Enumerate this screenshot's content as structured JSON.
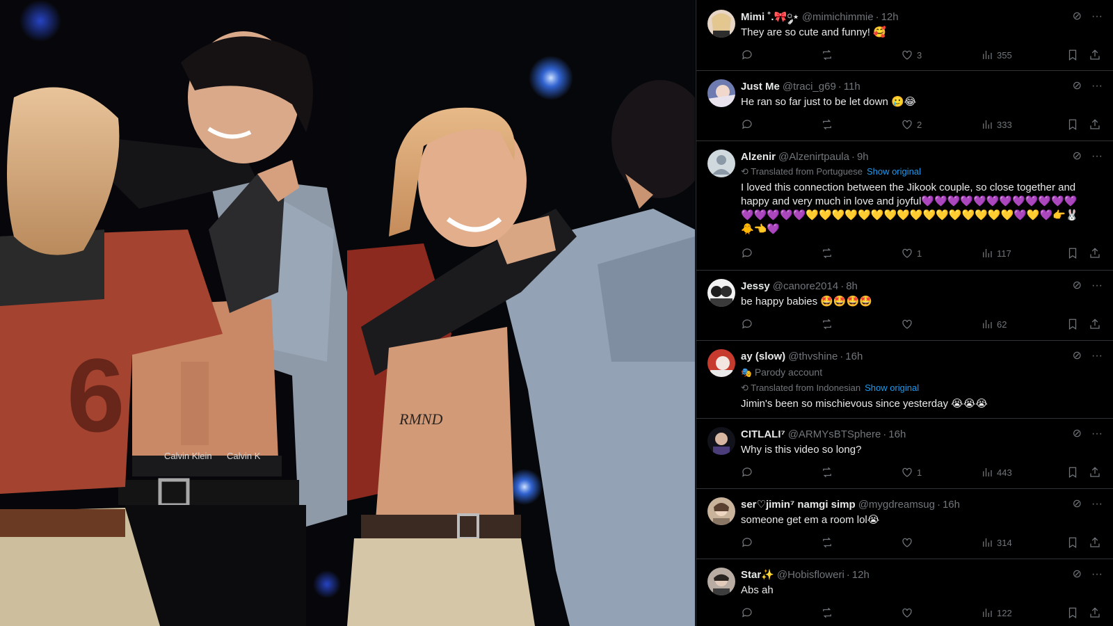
{
  "icons": {
    "reply": "reply-icon",
    "repost": "repost-icon",
    "like": "like-icon",
    "views": "views-icon",
    "bookmark": "bookmark-icon",
    "share": "share-icon",
    "grok": "grok-icon",
    "more": "more-icon"
  },
  "photos": {
    "left_waistband_text": "Calvin Klein",
    "left_waistband_text2": "Calvin K",
    "right_tattoo_text": "RMND"
  },
  "replies": [
    {
      "display_name": "Mimi ˚.🎀༘⋆",
      "handle": "@mimichimmie",
      "time": "12h",
      "text": "They are so cute and funny! 🥰",
      "likes": "3",
      "views": "355"
    },
    {
      "display_name": "Just Me",
      "handle": "@traci_g69",
      "time": "11h",
      "text": "He ran so far just to be let down 🥲😂",
      "likes": "2",
      "views": "333"
    },
    {
      "display_name": "Alzenir",
      "handle": "@Alzenirtpaula",
      "time": "9h",
      "translated": "Translated from Portuguese",
      "show_original": "Show original",
      "text": "I loved this connection between the Jikook couple, so close together and happy and very much in love and joyful💜💜💜💜💜💜💜💜💜💜💜💜💜💜💜💜💜💛💛💛💛💛💛💛💛💛💛💛💛💛💛💛💛💜💛💜👉🐰🐥👈💜",
      "likes": "1",
      "views": "117"
    },
    {
      "display_name": "Jessy",
      "handle": "@canore2014",
      "time": "8h",
      "text": "be happy babies 🤩🤩🤩🤩",
      "likes": "",
      "views": "62"
    },
    {
      "display_name": "ay (slow)",
      "handle": "@thvshine",
      "time": "16h",
      "parody": "Parody account",
      "translated": "Translated from Indonesian",
      "show_original": "Show original",
      "text": "Jimin's been so mischievous since yesterday 😭😭😭"
    },
    {
      "display_name": "CITLALI⁷",
      "handle": "@ARMYsBTSphere",
      "time": "16h",
      "text": "Why is this video so long?",
      "likes": "1",
      "views": "443"
    },
    {
      "display_name": "ser♡jimin⁷ namgi simp",
      "handle": "@mygdreamsug",
      "time": "16h",
      "text": "someone get em a room lol😭",
      "likes": "",
      "views": "314"
    },
    {
      "display_name": "Star✨",
      "handle": "@Hobisfloweri",
      "time": "12h",
      "text": "Abs ah",
      "likes": "",
      "views": "122"
    }
  ]
}
